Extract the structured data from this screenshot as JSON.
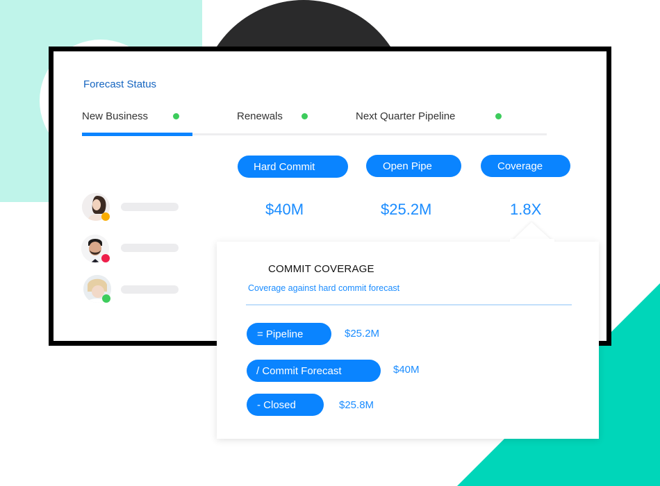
{
  "colors": {
    "accent": "#0a84ff",
    "title_blue": "#1565c0",
    "value_blue": "#1a8cff",
    "mint": "#bff4ea",
    "teal": "#00d6b9",
    "dark": "#2a2a2b",
    "status_green": "#3dcc5c",
    "status_orange": "#f9ac00",
    "status_red": "#ee1f4b"
  },
  "header": {
    "title": "Forecast Status"
  },
  "tabs": [
    {
      "label": "New Business",
      "active": true,
      "status": "green"
    },
    {
      "label": "Renewals",
      "active": false,
      "status": "green"
    },
    {
      "label": "Next Quarter Pipeline",
      "active": false,
      "status": "green"
    }
  ],
  "metrics": [
    {
      "label": "Hard Commit",
      "value": "$40M"
    },
    {
      "label": "Open Pipe",
      "value": "$25.2M"
    },
    {
      "label": "Coverage",
      "value": "1.8X"
    }
  ],
  "people": [
    {
      "status": "away",
      "status_color": "#f9ac00"
    },
    {
      "status": "busy",
      "status_color": "#ee1f4b"
    },
    {
      "status": "online",
      "status_color": "#3dcc5c"
    }
  ],
  "popover": {
    "title": "COMMIT COVERAGE",
    "subtitle": "Coverage against hard commit forecast",
    "rows": [
      {
        "label": "= Pipeline",
        "value": "$25.2M"
      },
      {
        "label": "/ Commit Forecast",
        "value": "$40M"
      },
      {
        "label": "- Closed",
        "value": "$25.8M"
      }
    ]
  }
}
